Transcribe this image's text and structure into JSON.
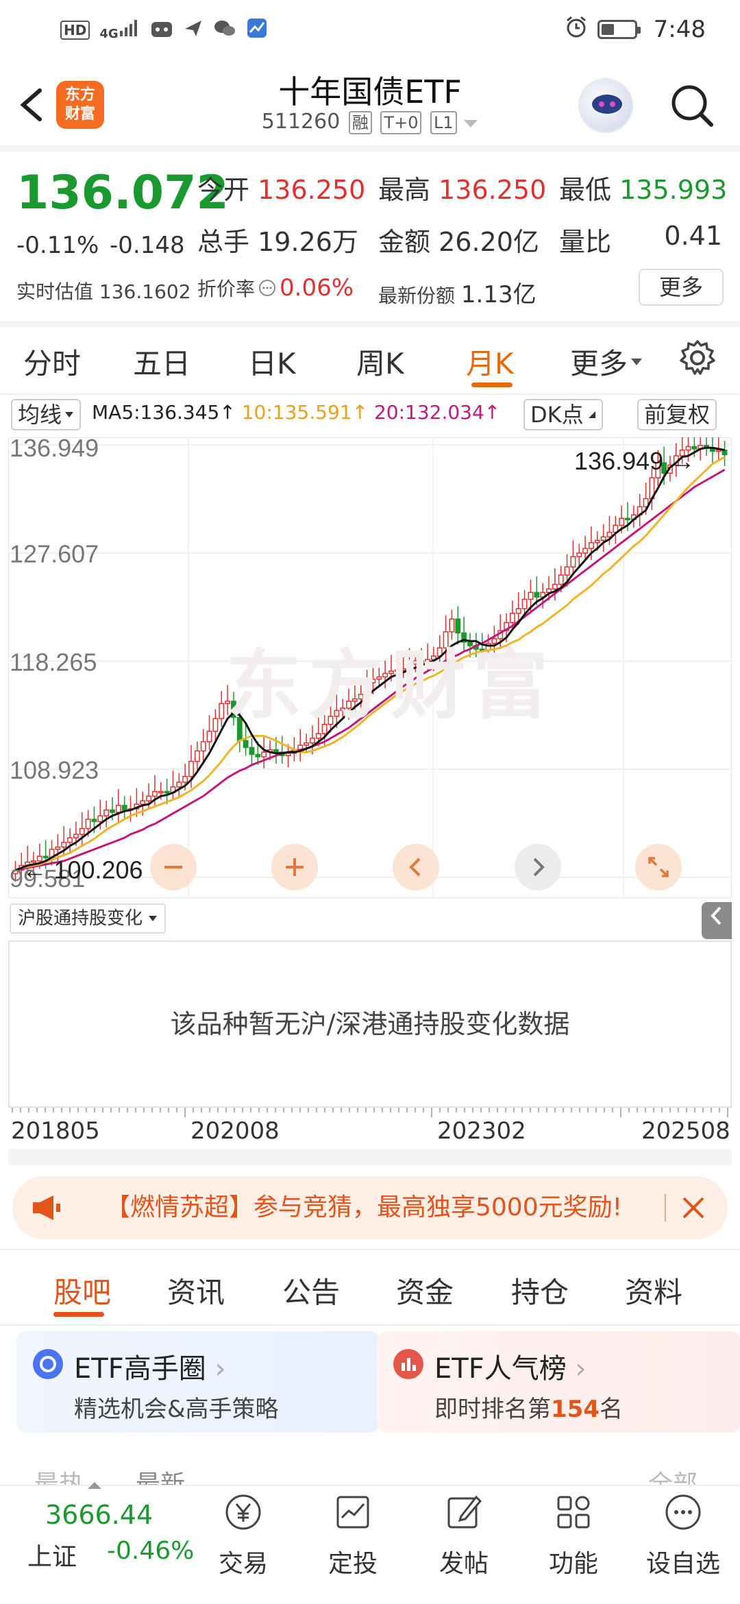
{
  "status_bar": {
    "left_text": "HD",
    "signal_text": "4G",
    "time": "7:48"
  },
  "header": {
    "title": "十年国债ETF",
    "code": "511260",
    "tags": [
      "融",
      "T+0",
      "L1"
    ],
    "logo_line1": "东方",
    "logo_line2": "财富"
  },
  "quote": {
    "price": "136.072",
    "change_pct": "-0.11%",
    "change": "-0.148",
    "open_label": "今开",
    "open": "136.250",
    "high_label": "最高",
    "high": "136.250",
    "low_label": "最低",
    "low": "135.993",
    "volume_label": "总手",
    "volume": "19.26万",
    "amount_label": "金额",
    "amount": "26.20亿",
    "ratio_label": "量比",
    "ratio": "0.41",
    "iopv_label": "实时估值",
    "iopv": "136.1602",
    "discount_label": "折价率",
    "discount": "0.06%",
    "shares_label": "最新份额",
    "shares": "1.13亿",
    "more": "更多"
  },
  "k_tabs": [
    "分时",
    "五日",
    "日K",
    "周K",
    "月K",
    "更多"
  ],
  "active_k_tab": "月K",
  "chart_controls": {
    "ma_button": "均线",
    "ma5": "MA5:136.345↑",
    "ma10": "10:135.591↑",
    "ma20": "20:132.034↑",
    "dk_button": "DK点",
    "adjust_button": "前复权",
    "watermark": "东方财富"
  },
  "chart_data": {
    "type": "candlestick",
    "y_ticks": [
      "136.949",
      "127.607",
      "118.265",
      "108.923",
      "99.581"
    ],
    "ylim": [
      97.8,
      137.6
    ],
    "max_label": "136.949",
    "min_label": "100.206",
    "x_ticks": [
      "201805",
      "202008",
      "202302",
      "202508"
    ],
    "ma_colors": {
      "ma5": "#111111",
      "ma10": "#f0b429",
      "ma20": "#c2187a"
    },
    "up_color": "#e0312f",
    "down_color": "#1a9a2e",
    "close": [
      100.2,
      100.6,
      100.9,
      101.0,
      101.4,
      101.3,
      102.0,
      102.2,
      102.6,
      103.0,
      103.3,
      103.8,
      104.6,
      104.4,
      104.9,
      105.4,
      105.2,
      105.8,
      105.4,
      105.5,
      105.9,
      106.2,
      106.6,
      107.0,
      107.0,
      106.9,
      107.4,
      107.8,
      108.3,
      109.6,
      110.5,
      111.3,
      112.2,
      113.3,
      114.6,
      114.8,
      113.4,
      111.4,
      110.8,
      110.2,
      110.0,
      110.4,
      110.6,
      110.4,
      110.1,
      110.3,
      110.6,
      111.0,
      111.2,
      111.6,
      112.0,
      112.8,
      113.5,
      114.0,
      114.2,
      114.8,
      115.0,
      115.4,
      116.4,
      116.7,
      116.9,
      117.2,
      117.4,
      117.5,
      117.6,
      118.0,
      118.3,
      118.1,
      118.4,
      118.7,
      119.4,
      120.8,
      121.9,
      120.7,
      119.9,
      119.6,
      119.3,
      119.2,
      119.8,
      120.2,
      120.9,
      121.6,
      122.4,
      122.8,
      123.6,
      124.2,
      123.8,
      124.2,
      124.5,
      124.9,
      125.7,
      126.4,
      127.3,
      127.6,
      128.0,
      128.5,
      128.7,
      129.0,
      129.4,
      130.0,
      130.6,
      130.5,
      130.9,
      131.6,
      132.3,
      134.1,
      135.4,
      134.5,
      135.2,
      136.0,
      136.5,
      136.8,
      136.6,
      136.9,
      136.7,
      136.4,
      136.5,
      136.1
    ],
    "ma5": [
      100.2,
      100.4,
      100.6,
      100.7,
      100.8,
      101.0,
      101.3,
      101.6,
      101.9,
      102.3,
      102.6,
      103.0,
      103.4,
      103.8,
      104.2,
      104.6,
      104.9,
      105.1,
      105.3,
      105.4,
      105.6,
      105.8,
      105.9,
      106.3,
      106.6,
      106.7,
      106.9,
      107.2,
      107.5,
      108.0,
      108.7,
      109.5,
      110.3,
      111.3,
      112.3,
      113.3,
      113.8,
      113.6,
      112.9,
      111.9,
      111.1,
      110.6,
      110.4,
      110.3,
      110.3,
      110.4,
      110.4,
      110.5,
      110.7,
      110.9,
      111.3,
      111.7,
      112.3,
      112.8,
      113.3,
      113.8,
      114.3,
      114.7,
      115.2,
      115.7,
      116.1,
      116.5,
      116.9,
      117.1,
      117.3,
      117.5,
      117.7,
      117.9,
      118.1,
      118.3,
      118.6,
      119.1,
      119.6,
      119.9,
      120.1,
      120.0,
      120.0,
      119.7,
      119.6,
      119.6,
      119.9,
      120.3,
      121.0,
      121.6,
      122.3,
      122.9,
      123.4,
      123.7,
      124.1,
      124.3,
      124.6,
      125.1,
      125.8,
      126.4,
      127.0,
      127.6,
      128.0,
      128.5,
      128.8,
      129.3,
      129.7,
      130.0,
      130.5,
      130.9,
      131.3,
      132.3,
      133.2,
      134.2,
      135.0,
      135.4,
      135.9,
      136.0,
      136.3,
      136.6,
      136.7,
      136.7,
      136.6,
      136.5
    ],
    "ma10": [
      100.2,
      100.4,
      100.5,
      100.6,
      100.7,
      100.9,
      101.1,
      101.3,
      101.5,
      101.7,
      102.0,
      102.3,
      102.6,
      102.9,
      103.3,
      103.7,
      104.0,
      104.3,
      104.6,
      104.9,
      105.1,
      105.3,
      105.5,
      105.7,
      105.9,
      106.1,
      106.3,
      106.5,
      106.8,
      107.1,
      107.5,
      107.9,
      108.4,
      109.0,
      109.6,
      110.3,
      110.9,
      111.4,
      111.6,
      111.8,
      111.8,
      111.8,
      111.6,
      111.4,
      111.1,
      110.9,
      110.6,
      110.4,
      110.4,
      110.5,
      110.7,
      110.9,
      111.1,
      111.4,
      111.7,
      112.1,
      112.5,
      112.9,
      113.4,
      113.8,
      114.2,
      114.6,
      115.0,
      115.4,
      115.7,
      116.0,
      116.3,
      116.5,
      116.8,
      117.0,
      117.3,
      117.6,
      118.0,
      118.3,
      118.6,
      118.8,
      119.0,
      119.1,
      119.2,
      119.3,
      119.4,
      119.6,
      119.9,
      120.1,
      120.5,
      120.8,
      121.2,
      121.5,
      121.9,
      122.3,
      122.7,
      123.1,
      123.6,
      124.0,
      124.4,
      124.8,
      125.3,
      125.8,
      126.2,
      126.7,
      127.2,
      127.7,
      128.2,
      128.6,
      129.1,
      129.7,
      130.3,
      130.9,
      131.5,
      132.1,
      132.7,
      133.3,
      133.8,
      134.3,
      134.8,
      135.3,
      135.6,
      135.9
    ],
    "ma20": [
      100.2,
      100.3,
      100.4,
      100.5,
      100.6,
      100.7,
      100.8,
      100.9,
      101.0,
      101.2,
      101.4,
      101.6,
      101.8,
      102.0,
      102.2,
      102.4,
      102.6,
      102.8,
      103.0,
      103.3,
      103.5,
      103.7,
      104.0,
      104.2,
      104.5,
      104.8,
      105.1,
      105.4,
      105.7,
      106.0,
      106.3,
      106.6,
      107.0,
      107.4,
      107.8,
      108.2,
      108.5,
      108.8,
      109.0,
      109.3,
      109.5,
      109.7,
      109.9,
      110.1,
      110.3,
      110.4,
      110.5,
      110.6,
      110.7,
      110.9,
      111.1,
      111.3,
      111.6,
      111.9,
      112.2,
      112.5,
      112.9,
      113.3,
      113.7,
      114.1,
      114.5,
      114.9,
      115.3,
      115.7,
      116.1,
      116.4,
      116.8,
      117.1,
      117.4,
      117.7,
      118.0,
      118.3,
      118.6,
      118.8,
      119.1,
      119.3,
      119.6,
      119.8,
      120.1,
      120.4,
      120.7,
      121.0,
      121.3,
      121.7,
      122.1,
      122.5,
      122.9,
      123.3,
      123.7,
      124.1,
      124.5,
      124.9,
      125.3,
      125.7,
      126.1,
      126.5,
      126.9,
      127.3,
      127.7,
      128.1,
      128.5,
      128.9,
      129.3,
      129.7,
      130.1,
      130.5,
      130.9,
      131.3,
      131.7,
      132.1,
      132.5,
      132.9,
      133.3,
      133.6,
      133.9,
      134.2,
      134.5,
      134.8
    ]
  },
  "holdings": {
    "selector": "沪股通持股变化",
    "empty_text": "该品种暂无沪/深港通持股变化数据"
  },
  "banner": {
    "text": "【燃情苏超】参与竞猜，最高独享5000元奖励!"
  },
  "bottom_tabs": [
    "股吧",
    "资讯",
    "公告",
    "资金",
    "持仓",
    "资料"
  ],
  "active_bottom_tab": "股吧",
  "cards": [
    {
      "title": "ETF高手圈",
      "subtitle": "精选机会&高手策略"
    },
    {
      "title": "ETF人气榜",
      "subtitle_prefix": "即时排名第",
      "rank": "154",
      "subtitle_suffix": "名"
    }
  ],
  "peek_row": {
    "left": "最热",
    "middle": "最新",
    "right": "全部"
  },
  "index": {
    "value": "3666.44",
    "name": "上证",
    "change": "-0.46%"
  },
  "nav": [
    "交易",
    "定投",
    "发帖",
    "功能",
    "设自选"
  ]
}
